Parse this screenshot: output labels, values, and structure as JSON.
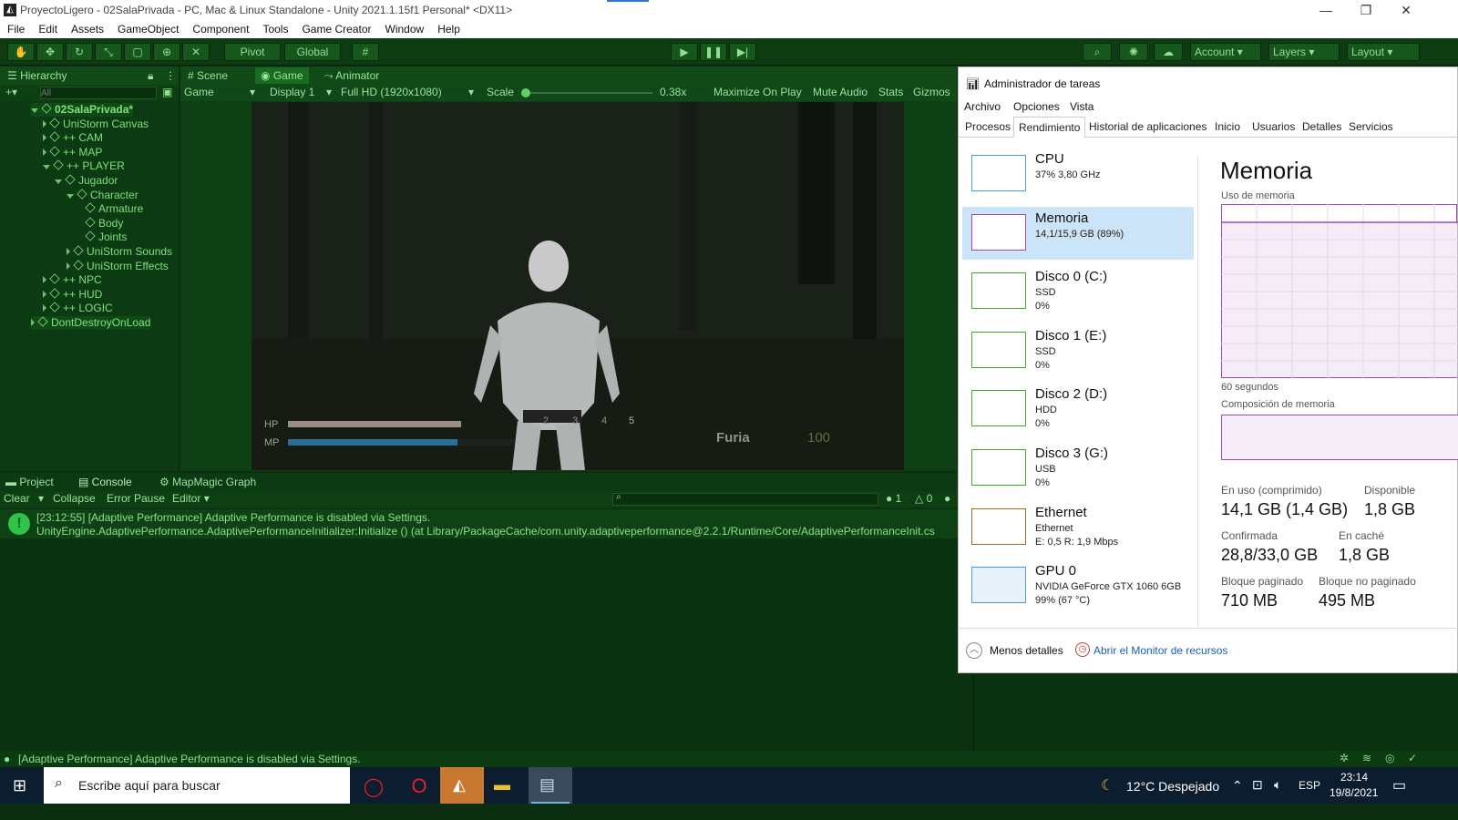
{
  "window": {
    "title": "ProyectoLigero - 02SalaPrivada - PC, Mac & Linux Standalone - Unity 2021.1.15f1 Personal* <DX11>",
    "logo": "unity-logo",
    "minimize": "—",
    "maximize": "❐",
    "close": "✕"
  },
  "menu": [
    "File",
    "Edit",
    "Assets",
    "GameObject",
    "Component",
    "Tools",
    "Game Creator",
    "Window",
    "Help"
  ],
  "toolbar": {
    "pivot": "Pivot",
    "global": "Global",
    "account": "Account",
    "layers": "Layers",
    "layout": "Layout"
  },
  "hierarchy": {
    "tab": "Hierarchy",
    "search_placeholder": "All",
    "items": [
      {
        "label": "02SalaPrivada*",
        "depth": 0
      },
      {
        "label": "UniStorm Canvas",
        "depth": 1
      },
      {
        "label": "++ CAM",
        "depth": 1
      },
      {
        "label": "++ MAP",
        "depth": 1
      },
      {
        "label": "++ PLAYER",
        "depth": 1
      },
      {
        "label": "Jugador",
        "depth": 2
      },
      {
        "label": "Character",
        "depth": 3
      },
      {
        "label": "Armature",
        "depth": 4
      },
      {
        "label": "Body",
        "depth": 4
      },
      {
        "label": "Joints",
        "depth": 4
      },
      {
        "label": "UniStorm Sounds",
        "depth": 3
      },
      {
        "label": "UniStorm Effects",
        "depth": 3
      },
      {
        "label": "++ NPC",
        "depth": 1
      },
      {
        "label": "++ HUD",
        "depth": 1
      },
      {
        "label": "++ LOGIC",
        "depth": 1
      },
      {
        "label": "DontDestroyOnLoad",
        "depth": 0
      }
    ]
  },
  "view_tabs": {
    "scene": "Scene",
    "game": "Game",
    "animator": "Animator"
  },
  "game_toolbar": {
    "game": "Game",
    "display": "Display 1",
    "resolution": "Full HD (1920x1080)",
    "scale_label": "Scale",
    "scale_value": "0.38x",
    "maximize": "Maximize On Play",
    "mute": "Mute Audio",
    "stats": "Stats",
    "gizmos": "Gizmos"
  },
  "hud": {
    "hp": "HP",
    "mp": "MP",
    "hp_fill": 0.99,
    "mp_fill": 0.75,
    "slots": [
      "2",
      "3",
      "4",
      "5"
    ],
    "rage": "Furia",
    "rage_value": "100"
  },
  "bottom_tabs": {
    "project": "Project",
    "console": "Console",
    "mapmagic": "MapMagic Graph"
  },
  "console": {
    "clear": "Clear",
    "collapse": "Collapse",
    "error_pause": "Error Pause",
    "editor": "Editor",
    "count_info": "1",
    "count_warn": "0",
    "line1": "[23:12:55] [Adaptive Performance] Adaptive Performance is disabled via Settings.",
    "line2": "UnityEngine.AdaptivePerformance.AdaptivePerformanceInitializer:Initialize () (at Library/PackageCache/com.unity.adaptiveperformance@2.2.1/Runtime/Core/AdaptivePerformanceInit.cs"
  },
  "status": "[Adaptive Performance] Adaptive Performance is disabled via Settings.",
  "taskmgr": {
    "title": "Administrador de tareas",
    "menu": [
      "Archivo",
      "Opciones",
      "Vista"
    ],
    "tabs": [
      "Procesos",
      "Rendimiento",
      "Historial de aplicaciones",
      "Inicio",
      "Usuarios",
      "Detalles",
      "Servicios"
    ],
    "items": [
      {
        "name": "CPU",
        "l1": "37% 3,80 GHz",
        "l2": ""
      },
      {
        "name": "Memoria",
        "l1": "14,1/15,9 GB (89%)",
        "l2": ""
      },
      {
        "name": "Disco 0 (C:)",
        "l1": "SSD",
        "l2": "0%"
      },
      {
        "name": "Disco 1 (E:)",
        "l1": "SSD",
        "l2": "0%"
      },
      {
        "name": "Disco 2 (D:)",
        "l1": "HDD",
        "l2": "0%"
      },
      {
        "name": "Disco 3 (G:)",
        "l1": "USB",
        "l2": "0%"
      },
      {
        "name": "Ethernet",
        "l1": "Ethernet",
        "l2": "E: 0,5 R: 1,9 Mbps"
      },
      {
        "name": "GPU 0",
        "l1": "NVIDIA GeForce GTX 1060 6GB",
        "l2": "99% (67 °C)"
      }
    ],
    "heading": "Memoria",
    "usage_label": "Uso de memoria",
    "seconds": "60 segundos",
    "composition": "Composición de memoria",
    "stats": {
      "inuse_l": "En uso (comprimido)",
      "inuse_v": "14,1 GB (1,4 GB)",
      "avail_l": "Disponible",
      "avail_v": "1,8 GB",
      "commit_l": "Confirmada",
      "commit_v": "28,8/33,0 GB",
      "cache_l": "En caché",
      "cache_v": "1,8 GB",
      "paged_l": "Bloque paginado",
      "paged_v": "710 MB",
      "nonpaged_l": "Bloque no paginado",
      "nonpaged_v": "495 MB"
    },
    "less": "Menos detalles",
    "monitor": "Abrir el Monitor de recursos"
  },
  "taskbar": {
    "search": "Escribe aquí para buscar",
    "weather": "12°C  Despejado",
    "lang": "ESP",
    "time": "23:14",
    "date": "19/8/2021"
  }
}
